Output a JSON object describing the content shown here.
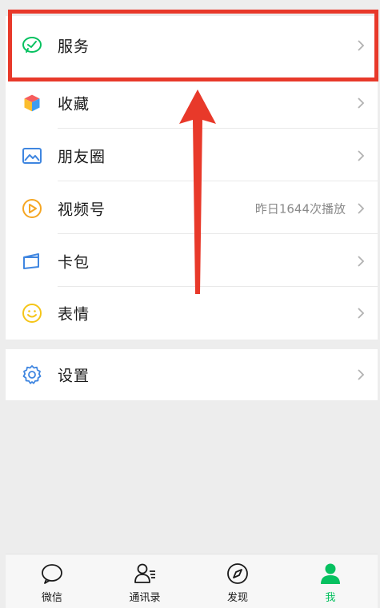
{
  "menu": {
    "services": {
      "label": "服务",
      "icon": "wechat-pay-icon"
    },
    "items": [
      {
        "label": "收藏",
        "icon": "favorites-cube-icon",
        "extra": ""
      },
      {
        "label": "朋友圈",
        "icon": "moments-image-icon",
        "extra": ""
      },
      {
        "label": "视频号",
        "icon": "channels-play-icon",
        "extra": "昨日1644次播放"
      },
      {
        "label": "卡包",
        "icon": "card-wallet-icon",
        "extra": ""
      },
      {
        "label": "表情",
        "icon": "sticker-smile-icon",
        "extra": ""
      }
    ],
    "settings": {
      "label": "设置",
      "icon": "gear-icon"
    }
  },
  "tabbar": {
    "tabs": [
      {
        "label": "微信",
        "icon": "chat-bubble-icon",
        "active": false
      },
      {
        "label": "通讯录",
        "icon": "contacts-icon",
        "active": false
      },
      {
        "label": "发现",
        "icon": "compass-icon",
        "active": false
      },
      {
        "label": "我",
        "icon": "person-icon",
        "active": true
      }
    ]
  },
  "colors": {
    "accent": "#07c160",
    "highlight": "#e8392a",
    "background": "#ededed"
  }
}
